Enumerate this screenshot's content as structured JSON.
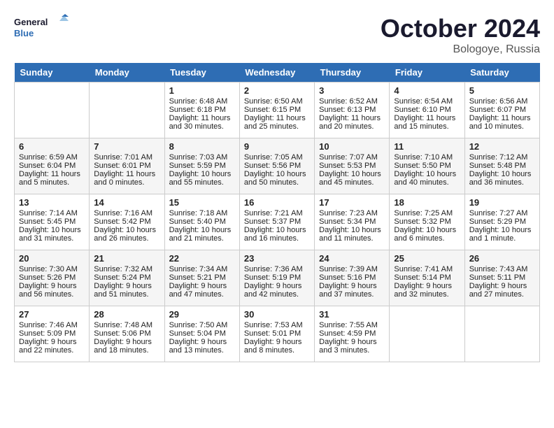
{
  "header": {
    "logo_line1": "General",
    "logo_line2": "Blue",
    "month": "October 2024",
    "location": "Bologoye, Russia"
  },
  "days_of_week": [
    "Sunday",
    "Monday",
    "Tuesday",
    "Wednesday",
    "Thursday",
    "Friday",
    "Saturday"
  ],
  "weeks": [
    [
      {
        "day": "",
        "info": ""
      },
      {
        "day": "",
        "info": ""
      },
      {
        "day": "1",
        "sunrise": "6:48 AM",
        "sunset": "6:18 PM",
        "daylight": "11 hours and 30 minutes."
      },
      {
        "day": "2",
        "sunrise": "6:50 AM",
        "sunset": "6:15 PM",
        "daylight": "11 hours and 25 minutes."
      },
      {
        "day": "3",
        "sunrise": "6:52 AM",
        "sunset": "6:13 PM",
        "daylight": "11 hours and 20 minutes."
      },
      {
        "day": "4",
        "sunrise": "6:54 AM",
        "sunset": "6:10 PM",
        "daylight": "11 hours and 15 minutes."
      },
      {
        "day": "5",
        "sunrise": "6:56 AM",
        "sunset": "6:07 PM",
        "daylight": "11 hours and 10 minutes."
      }
    ],
    [
      {
        "day": "6",
        "sunrise": "6:59 AM",
        "sunset": "6:04 PM",
        "daylight": "11 hours and 5 minutes."
      },
      {
        "day": "7",
        "sunrise": "7:01 AM",
        "sunset": "6:01 PM",
        "daylight": "11 hours and 0 minutes."
      },
      {
        "day": "8",
        "sunrise": "7:03 AM",
        "sunset": "5:59 PM",
        "daylight": "10 hours and 55 minutes."
      },
      {
        "day": "9",
        "sunrise": "7:05 AM",
        "sunset": "5:56 PM",
        "daylight": "10 hours and 50 minutes."
      },
      {
        "day": "10",
        "sunrise": "7:07 AM",
        "sunset": "5:53 PM",
        "daylight": "10 hours and 45 minutes."
      },
      {
        "day": "11",
        "sunrise": "7:10 AM",
        "sunset": "5:50 PM",
        "daylight": "10 hours and 40 minutes."
      },
      {
        "day": "12",
        "sunrise": "7:12 AM",
        "sunset": "5:48 PM",
        "daylight": "10 hours and 36 minutes."
      }
    ],
    [
      {
        "day": "13",
        "sunrise": "7:14 AM",
        "sunset": "5:45 PM",
        "daylight": "10 hours and 31 minutes."
      },
      {
        "day": "14",
        "sunrise": "7:16 AM",
        "sunset": "5:42 PM",
        "daylight": "10 hours and 26 minutes."
      },
      {
        "day": "15",
        "sunrise": "7:18 AM",
        "sunset": "5:40 PM",
        "daylight": "10 hours and 21 minutes."
      },
      {
        "day": "16",
        "sunrise": "7:21 AM",
        "sunset": "5:37 PM",
        "daylight": "10 hours and 16 minutes."
      },
      {
        "day": "17",
        "sunrise": "7:23 AM",
        "sunset": "5:34 PM",
        "daylight": "10 hours and 11 minutes."
      },
      {
        "day": "18",
        "sunrise": "7:25 AM",
        "sunset": "5:32 PM",
        "daylight": "10 hours and 6 minutes."
      },
      {
        "day": "19",
        "sunrise": "7:27 AM",
        "sunset": "5:29 PM",
        "daylight": "10 hours and 1 minute."
      }
    ],
    [
      {
        "day": "20",
        "sunrise": "7:30 AM",
        "sunset": "5:26 PM",
        "daylight": "9 hours and 56 minutes."
      },
      {
        "day": "21",
        "sunrise": "7:32 AM",
        "sunset": "5:24 PM",
        "daylight": "9 hours and 51 minutes."
      },
      {
        "day": "22",
        "sunrise": "7:34 AM",
        "sunset": "5:21 PM",
        "daylight": "9 hours and 47 minutes."
      },
      {
        "day": "23",
        "sunrise": "7:36 AM",
        "sunset": "5:19 PM",
        "daylight": "9 hours and 42 minutes."
      },
      {
        "day": "24",
        "sunrise": "7:39 AM",
        "sunset": "5:16 PM",
        "daylight": "9 hours and 37 minutes."
      },
      {
        "day": "25",
        "sunrise": "7:41 AM",
        "sunset": "5:14 PM",
        "daylight": "9 hours and 32 minutes."
      },
      {
        "day": "26",
        "sunrise": "7:43 AM",
        "sunset": "5:11 PM",
        "daylight": "9 hours and 27 minutes."
      }
    ],
    [
      {
        "day": "27",
        "sunrise": "7:46 AM",
        "sunset": "5:09 PM",
        "daylight": "9 hours and 22 minutes."
      },
      {
        "day": "28",
        "sunrise": "7:48 AM",
        "sunset": "5:06 PM",
        "daylight": "9 hours and 18 minutes."
      },
      {
        "day": "29",
        "sunrise": "7:50 AM",
        "sunset": "5:04 PM",
        "daylight": "9 hours and 13 minutes."
      },
      {
        "day": "30",
        "sunrise": "7:53 AM",
        "sunset": "5:01 PM",
        "daylight": "9 hours and 8 minutes."
      },
      {
        "day": "31",
        "sunrise": "7:55 AM",
        "sunset": "4:59 PM",
        "daylight": "9 hours and 3 minutes."
      },
      {
        "day": "",
        "info": ""
      },
      {
        "day": "",
        "info": ""
      }
    ]
  ]
}
